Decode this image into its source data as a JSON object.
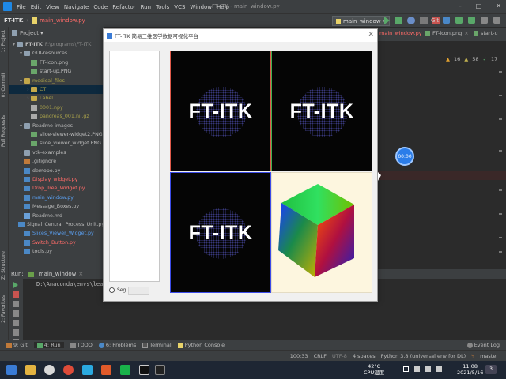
{
  "menubar": {
    "items": [
      "File",
      "Edit",
      "View",
      "Navigate",
      "Code",
      "Refactor",
      "Run",
      "Tools",
      "VCS",
      "Window",
      "Help"
    ],
    "window_title": "FT-ITK - main_window.py"
  },
  "navbar": {
    "project": "FT-ITK",
    "file": "main_window.py",
    "run_config": "main_window",
    "git_label": "Git:"
  },
  "left_strip": {
    "project_tab": "1: Project",
    "commit_tab": "0: Commit",
    "pull_requests_tab": "Pull Requests",
    "structure_tab": "Z: Structure",
    "favorites_tab": "2: Favorites"
  },
  "project_panel": {
    "title": "Project",
    "tree": [
      {
        "name": "FT-ITK",
        "extra": "F:\\programs\\FT-ITK",
        "indent": 0,
        "arrow": "▾",
        "icon": "folder",
        "color": "default"
      },
      {
        "name": "GUI-resources",
        "indent": 1,
        "arrow": "▾",
        "icon": "folder",
        "color": "default"
      },
      {
        "name": "FT-icon.png",
        "indent": 2,
        "arrow": "",
        "icon": "png",
        "color": "default"
      },
      {
        "name": "start-up.PNG",
        "indent": 2,
        "arrow": "",
        "icon": "png",
        "color": "default"
      },
      {
        "name": "medical_files",
        "indent": 1,
        "arrow": "▾",
        "icon": "folder-y",
        "color": "olive"
      },
      {
        "name": "CT",
        "indent": 2,
        "arrow": "›",
        "icon": "folder-y",
        "color": "olive",
        "selected": true
      },
      {
        "name": "Label",
        "indent": 2,
        "arrow": "›",
        "icon": "folder-y",
        "color": "olive"
      },
      {
        "name": "0001.npy",
        "indent": 2,
        "arrow": "",
        "icon": "file",
        "color": "olive"
      },
      {
        "name": "pancreas_001.nii.gz",
        "indent": 2,
        "arrow": "",
        "icon": "file",
        "color": "olive"
      },
      {
        "name": "Readme-images",
        "indent": 1,
        "arrow": "▾",
        "icon": "folder",
        "color": "default"
      },
      {
        "name": "slice-viewer-widget2.PNG",
        "indent": 2,
        "arrow": "",
        "icon": "png",
        "color": "default"
      },
      {
        "name": "slice_viewer_widget.PNG",
        "indent": 2,
        "arrow": "",
        "icon": "png",
        "color": "default"
      },
      {
        "name": "vtk-examples",
        "indent": 1,
        "arrow": "›",
        "icon": "folder",
        "color": "default"
      },
      {
        "name": ".gitignore",
        "indent": 1,
        "arrow": "",
        "icon": "git",
        "color": "default"
      },
      {
        "name": "demopo.py",
        "indent": 1,
        "arrow": "",
        "icon": "py",
        "color": "default"
      },
      {
        "name": "Display_widget.py",
        "indent": 1,
        "arrow": "",
        "icon": "py",
        "color": "red"
      },
      {
        "name": "Drop_Tree_Widget.py",
        "indent": 1,
        "arrow": "",
        "icon": "py",
        "color": "red"
      },
      {
        "name": "main_window.py",
        "indent": 1,
        "arrow": "",
        "icon": "py",
        "color": "blue"
      },
      {
        "name": "Message_Boxes.py",
        "indent": 1,
        "arrow": "",
        "icon": "py",
        "color": "default"
      },
      {
        "name": "Readme.md",
        "indent": 1,
        "arrow": "",
        "icon": "md",
        "color": "default"
      },
      {
        "name": "Signal_Central_Process_Unit.py",
        "indent": 1,
        "arrow": "",
        "icon": "py",
        "color": "default"
      },
      {
        "name": "Slices_Viewer_Widget.py",
        "indent": 1,
        "arrow": "",
        "icon": "py",
        "color": "blue"
      },
      {
        "name": "Switch_Button.py",
        "indent": 1,
        "arrow": "",
        "icon": "py",
        "color": "red"
      },
      {
        "name": "tools.py",
        "indent": 1,
        "arrow": "",
        "icon": "py",
        "color": "default"
      }
    ]
  },
  "editor": {
    "tabs": [
      {
        "label": "main_window.py",
        "color": "#ff6b68"
      },
      {
        "label": "FT-icon.png",
        "color": "#bbbbbb"
      },
      {
        "label": "start-u",
        "color": "#bbbbbb"
      }
    ],
    "warnings": "16",
    "weak_warnings": "58",
    "typos": "17",
    "timer": "00:00"
  },
  "run_panel": {
    "label": "Run:",
    "config": "main_window",
    "console_line": "D:\\Anaconda\\envs\\lea"
  },
  "bottom_tabs": [
    {
      "label": "9: Git"
    },
    {
      "label": "4: Run",
      "active": true
    },
    {
      "label": "TODO"
    },
    {
      "label": "6: Problems"
    },
    {
      "label": "Terminal"
    },
    {
      "label": "Python Console"
    }
  ],
  "event_log": "Event Log",
  "status": {
    "position": "100:33",
    "line_sep": "CRLF",
    "encoding": "UTF-8",
    "indent": "4 spaces",
    "interpreter": "Python 3.8 (universal env for DL)",
    "branch": "master"
  },
  "taskbar": {
    "temperature": "42°C",
    "cpu_label": "CPU温度",
    "time": "11:08",
    "date": "2021/5/16",
    "notifications": "3"
  },
  "dialog": {
    "icon_text": "FT",
    "title": "FT-ITK   简易三维医学数据可视化平台",
    "radio_label": "Seg",
    "views": [
      {
        "logo": "FT-ITK",
        "border": "#e05a4a"
      },
      {
        "logo": "FT-ITK",
        "border": "#3fae4f"
      },
      {
        "logo": "FT-ITK",
        "border": "#3b4be8"
      },
      {
        "render": "rgb-color-cube"
      }
    ]
  },
  "colors": {
    "ide_bg": "#2b2b2b",
    "panel_bg": "#3c3f41",
    "selection": "#0d293e",
    "modified_file": "#ff6b68",
    "accent_blue": "#2b7de9"
  }
}
